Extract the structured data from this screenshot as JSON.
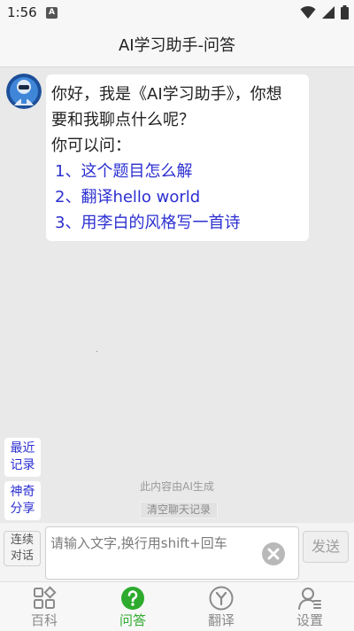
{
  "status": {
    "time": "1:56",
    "notification_badge": "A"
  },
  "header": {
    "title": "AI学习助手-问答"
  },
  "chat": {
    "greeting_line1": "你好，我是《AI学习助手》，你想",
    "greeting_line2": "要和我聊点什么呢？",
    "prompt": "你可以问：",
    "suggestions": [
      "1、这个题目怎么解",
      "2、翻译hello world",
      "3、用李白的风格写一首诗"
    ]
  },
  "side_buttons": {
    "recent_line1": "最近",
    "recent_line2": "记录",
    "share_line1": "神奇",
    "share_line2": "分享"
  },
  "ai_notice": "此内容由AI生成",
  "clear_chat_label": "清空聊天记录",
  "input": {
    "continuous_line1": "连续",
    "continuous_line2": "对话",
    "placeholder": "请输入文字,换行用shift+回车",
    "send_label": "发送"
  },
  "tabs": [
    {
      "label": "百科",
      "icon": "grid-icon",
      "active": false
    },
    {
      "label": "问答",
      "icon": "question-icon",
      "active": true
    },
    {
      "label": "翻译",
      "icon": "translate-y-icon",
      "active": false
    },
    {
      "label": "设置",
      "icon": "user-settings-icon",
      "active": false
    }
  ],
  "colors": {
    "accent_green": "#2eab2e",
    "link_blue": "#2b2fd0"
  }
}
